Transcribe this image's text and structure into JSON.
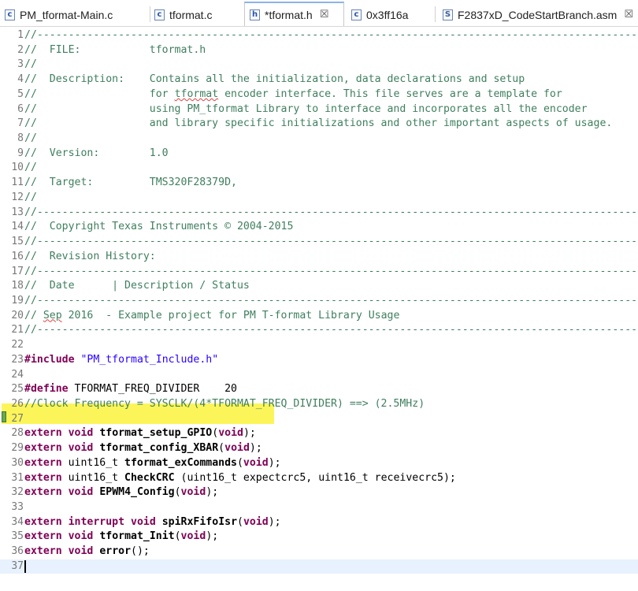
{
  "tabs": [
    {
      "label": "PM_tformat-Main.c",
      "icon": "c-file-icon",
      "icon_text": "c",
      "active": false,
      "closable": false
    },
    {
      "label": "tformat.c",
      "icon": "c-file-icon",
      "icon_text": "c",
      "active": false,
      "closable": false
    },
    {
      "label": "*tformat.h",
      "icon": "h-file-icon",
      "icon_text": "h",
      "active": true,
      "closable": true
    },
    {
      "label": "0x3ff16a",
      "icon": "c-file-icon",
      "icon_text": "c",
      "active": false,
      "closable": false
    },
    {
      "label": "F2837xD_CodeStartBranch.asm",
      "icon": "asm-file-icon",
      "icon_text": "S",
      "active": false,
      "closable": true
    }
  ],
  "close_glyph": "☒",
  "editor": {
    "current_line": 37,
    "highlighted_line": 25,
    "colors": {
      "comment": "#3f7f5f",
      "keyword": "#7f0055",
      "string": "#2a00ff",
      "highlight": "#fbf33c",
      "current_line_bg": "#e8f2fe"
    },
    "lines": [
      {
        "n": "1",
        "tokens": [
          {
            "c": "cm",
            "t": "//-------------------------------------------------------------------------------------------------------------"
          }
        ]
      },
      {
        "n": "2",
        "tokens": [
          {
            "c": "cm",
            "t": "//  FILE:           tformat.h"
          }
        ]
      },
      {
        "n": "3",
        "tokens": [
          {
            "c": "cm",
            "t": "//"
          }
        ]
      },
      {
        "n": "4",
        "tokens": [
          {
            "c": "cm",
            "t": "//  Description:    Contains all the initialization, data declarations and setup"
          }
        ]
      },
      {
        "n": "5",
        "tokens": [
          {
            "c": "cm",
            "t": "//                  for "
          },
          {
            "c": "cm squig",
            "t": "tformat"
          },
          {
            "c": "cm",
            "t": " encoder interface. This file serves are a template for"
          }
        ]
      },
      {
        "n": "6",
        "tokens": [
          {
            "c": "cm",
            "t": "//                  using PM_tformat Library to interface and incorporates all the encoder"
          }
        ]
      },
      {
        "n": "7",
        "tokens": [
          {
            "c": "cm",
            "t": "//                  and library specific initializations and other important aspects of usage."
          }
        ]
      },
      {
        "n": "8",
        "tokens": [
          {
            "c": "cm",
            "t": "//"
          }
        ]
      },
      {
        "n": "9",
        "tokens": [
          {
            "c": "cm",
            "t": "//  Version:        1.0"
          }
        ]
      },
      {
        "n": "10",
        "tokens": [
          {
            "c": "cm",
            "t": "//"
          }
        ]
      },
      {
        "n": "11",
        "tokens": [
          {
            "c": "cm",
            "t": "//  Target:         TMS320F28379D,"
          }
        ]
      },
      {
        "n": "12",
        "tokens": [
          {
            "c": "cm",
            "t": "//"
          }
        ]
      },
      {
        "n": "13",
        "tokens": [
          {
            "c": "cm",
            "t": "//-------------------------------------------------------------------------------------------------------------"
          }
        ]
      },
      {
        "n": "14",
        "tokens": [
          {
            "c": "cm",
            "t": "//  Copyright Texas Instruments © 2004-2015"
          }
        ]
      },
      {
        "n": "15",
        "tokens": [
          {
            "c": "cm",
            "t": "//-------------------------------------------------------------------------------------------------------------"
          }
        ]
      },
      {
        "n": "16",
        "tokens": [
          {
            "c": "cm",
            "t": "//  Revision History:"
          }
        ]
      },
      {
        "n": "17",
        "tokens": [
          {
            "c": "cm",
            "t": "//-------------------------------------------------------------------------------------------------------------"
          }
        ]
      },
      {
        "n": "18",
        "tokens": [
          {
            "c": "cm",
            "t": "//  Date      | Description / Status"
          }
        ]
      },
      {
        "n": "19",
        "tokens": [
          {
            "c": "cm",
            "t": "//-------------------------------------------------------------------------------------------------------------"
          }
        ]
      },
      {
        "n": "20",
        "tokens": [
          {
            "c": "cm",
            "t": "// "
          },
          {
            "c": "cm squig",
            "t": "Sep"
          },
          {
            "c": "cm",
            "t": " 2016  - Example project for PM T-format Library Usage"
          }
        ]
      },
      {
        "n": "21",
        "tokens": [
          {
            "c": "cm",
            "t": "//-------------------------------------------------------------------------------------------------------------"
          }
        ]
      },
      {
        "n": "22",
        "tokens": []
      },
      {
        "n": "23",
        "tokens": [
          {
            "c": "kw",
            "t": "#include"
          },
          {
            "c": "",
            "t": " "
          },
          {
            "c": "str",
            "t": "\"PM_tformat_Include.h\""
          }
        ]
      },
      {
        "n": "24",
        "tokens": []
      },
      {
        "n": "25",
        "tokens": [
          {
            "c": "kw",
            "t": "#define"
          },
          {
            "c": "",
            "t": " TFORMAT_FREQ_DIVIDER    20"
          }
        ]
      },
      {
        "n": "26",
        "tokens": [
          {
            "c": "cm",
            "t": "//Clock Frequency = SYSCLK/(4*TFORMAT_FREQ_DIVIDER) ==> (2.5MHz)"
          }
        ]
      },
      {
        "n": "27",
        "tokens": []
      },
      {
        "n": "28",
        "tokens": [
          {
            "c": "kw",
            "t": "extern"
          },
          {
            "c": "",
            "t": " "
          },
          {
            "c": "kw",
            "t": "void"
          },
          {
            "c": "",
            "t": " "
          },
          {
            "c": "fn",
            "t": "tformat_setup_GPIO"
          },
          {
            "c": "",
            "t": "("
          },
          {
            "c": "kw",
            "t": "void"
          },
          {
            "c": "",
            "t": ");"
          }
        ]
      },
      {
        "n": "29",
        "tokens": [
          {
            "c": "kw",
            "t": "extern"
          },
          {
            "c": "",
            "t": " "
          },
          {
            "c": "kw",
            "t": "void"
          },
          {
            "c": "",
            "t": " "
          },
          {
            "c": "fn",
            "t": "tformat_config_XBAR"
          },
          {
            "c": "",
            "t": "("
          },
          {
            "c": "kw",
            "t": "void"
          },
          {
            "c": "",
            "t": ");"
          }
        ]
      },
      {
        "n": "30",
        "tokens": [
          {
            "c": "kw",
            "t": "extern"
          },
          {
            "c": "",
            "t": " uint16_t "
          },
          {
            "c": "fn",
            "t": "tformat_exCommands"
          },
          {
            "c": "",
            "t": "("
          },
          {
            "c": "kw",
            "t": "void"
          },
          {
            "c": "",
            "t": ");"
          }
        ]
      },
      {
        "n": "31",
        "tokens": [
          {
            "c": "kw",
            "t": "extern"
          },
          {
            "c": "",
            "t": " uint16_t "
          },
          {
            "c": "fn",
            "t": "CheckCRC"
          },
          {
            "c": "",
            "t": " (uint16_t expectcrc5, uint16_t receivecrc5);"
          }
        ]
      },
      {
        "n": "32",
        "tokens": [
          {
            "c": "kw",
            "t": "extern"
          },
          {
            "c": "",
            "t": " "
          },
          {
            "c": "kw",
            "t": "void"
          },
          {
            "c": "",
            "t": " "
          },
          {
            "c": "fn",
            "t": "EPWM4_Config"
          },
          {
            "c": "",
            "t": "("
          },
          {
            "c": "kw",
            "t": "void"
          },
          {
            "c": "",
            "t": ");"
          }
        ]
      },
      {
        "n": "33",
        "tokens": []
      },
      {
        "n": "34",
        "tokens": [
          {
            "c": "kw",
            "t": "extern"
          },
          {
            "c": "",
            "t": " "
          },
          {
            "c": "kw",
            "t": "interrupt"
          },
          {
            "c": "",
            "t": " "
          },
          {
            "c": "kw",
            "t": "void"
          },
          {
            "c": "",
            "t": " "
          },
          {
            "c": "fn",
            "t": "spiRxFifoIsr"
          },
          {
            "c": "",
            "t": "("
          },
          {
            "c": "kw",
            "t": "void"
          },
          {
            "c": "",
            "t": ");"
          }
        ]
      },
      {
        "n": "35",
        "tokens": [
          {
            "c": "kw",
            "t": "extern"
          },
          {
            "c": "",
            "t": " "
          },
          {
            "c": "kw",
            "t": "void"
          },
          {
            "c": "",
            "t": " "
          },
          {
            "c": "fn",
            "t": "tformat_Init"
          },
          {
            "c": "",
            "t": "("
          },
          {
            "c": "kw",
            "t": "void"
          },
          {
            "c": "",
            "t": ");"
          }
        ]
      },
      {
        "n": "36",
        "tokens": [
          {
            "c": "kw",
            "t": "extern"
          },
          {
            "c": "",
            "t": " "
          },
          {
            "c": "kw",
            "t": "void"
          },
          {
            "c": "",
            "t": " "
          },
          {
            "c": "fn",
            "t": "error"
          },
          {
            "c": "",
            "t": "();"
          }
        ]
      },
      {
        "n": "37",
        "tokens": []
      }
    ]
  }
}
